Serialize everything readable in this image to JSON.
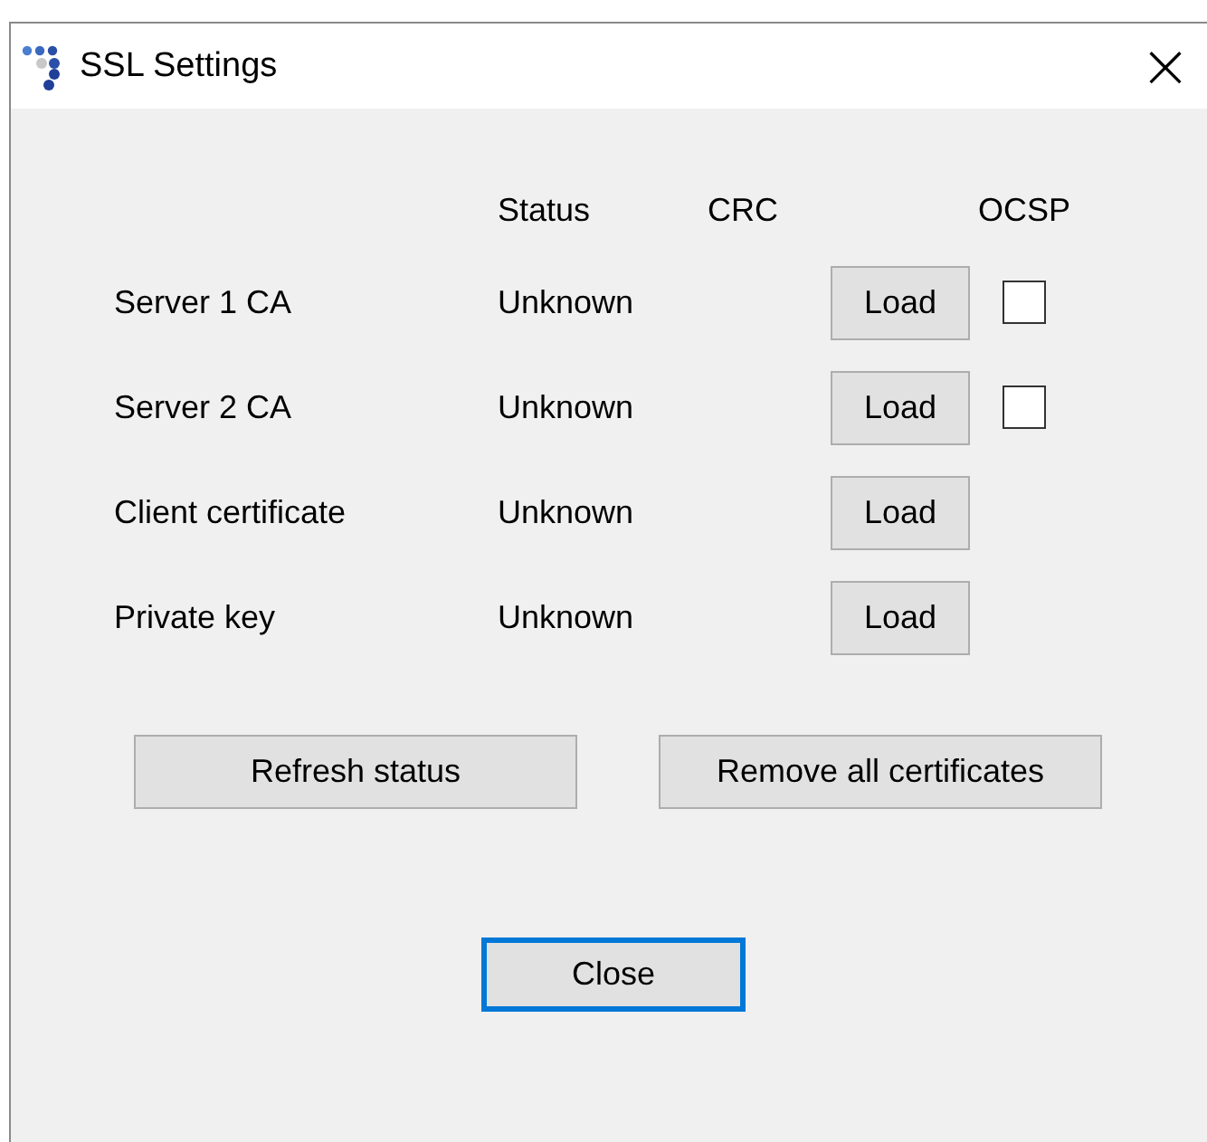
{
  "window": {
    "title": "SSL Settings",
    "close": "×"
  },
  "columns": [
    "Status",
    "CRC",
    "OCSP"
  ],
  "rows": [
    {
      "name": "Server 1 CA",
      "status": "Unknown",
      "button": "Load",
      "ocsp": {
        "checked": false
      }
    },
    {
      "name": "Server 2 CA",
      "status": "Unknown",
      "button": "Load",
      "ocsp": {
        "checked": false
      }
    },
    {
      "name": "Client certificate",
      "status": "Unknown",
      "button": "Load"
    },
    {
      "name": "Private key",
      "status": "Unknown",
      "button": "Load"
    }
  ],
  "actions": [
    "Refresh status",
    "Remove all certificates"
  ],
  "close_button": {
    "label": "Close",
    "focused": true
  }
}
